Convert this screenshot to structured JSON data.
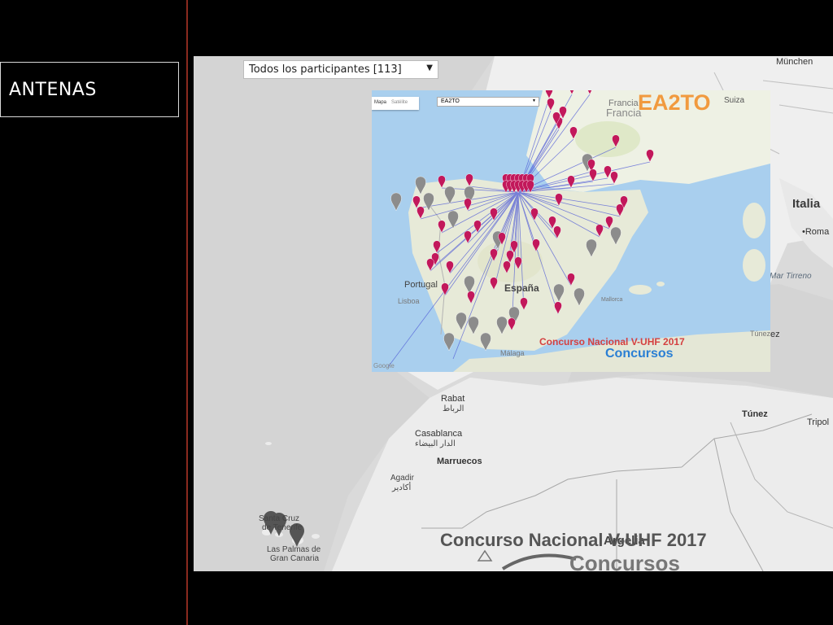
{
  "side_label": "ANTENAS",
  "participant_select": {
    "value": "Todos los participantes [113]"
  },
  "map_labels": {
    "munich": "München",
    "italia": "Italia",
    "roma": "•Roma",
    "mar_tirreno": "Mar Tirreno",
    "tunez_top": "Túnez",
    "tunez": "Túnez",
    "tripoli": "Tripol",
    "rabat": "Rabat",
    "rabat_ar": "الرباط",
    "casablanca": "Casablanca",
    "casablanca_ar": "الدار البيضاء",
    "marruecos": "Marruecos",
    "agadir": "Agadir",
    "agadir_ar": "أكادير",
    "santa_cruz": "Santa Cruz",
    "de_tenerife": "de Tenerife",
    "las_palmas": "Las Palmas de",
    "gran_canaria": "Gran Canaria",
    "argelia": "Argelia"
  },
  "bottom_banner": {
    "title": "Concurso Nacional V-UHF 2017",
    "subtitle": "Concursos"
  },
  "inset": {
    "tab_map": "Mapa",
    "tab_sat": "Satélite",
    "select_value": "EA2TO",
    "callsign": "EA2TO",
    "francia": "Francia",
    "francia_top": "Francia",
    "suiza": "Suiza",
    "espana": "España",
    "portugal": "Portugal",
    "lisboa": "Lisboa",
    "mallorca": "Mallorca",
    "malaga": "Málaga",
    "tunez": "Túnez",
    "contest_title": "Concurso Nacional V-UHF 2017",
    "contest_sub": "Concursos",
    "google": "Google"
  },
  "colors": {
    "marker_pink": "#c2185b",
    "marker_gray": "#8c8c8c",
    "link_blue": "#4a55d6",
    "callsign_orange": "#f19a3e",
    "contest_red": "#d44040",
    "contest_blue": "#2a7fd4"
  }
}
